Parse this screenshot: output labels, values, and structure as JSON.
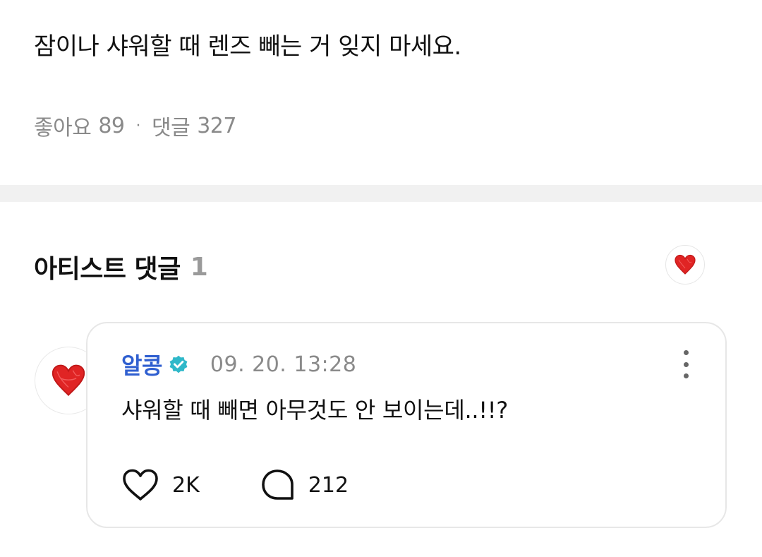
{
  "post": {
    "body": "잠이나 샤워할 때 렌즈 빼는 거 잊지 마세요.",
    "likes_label": "좋아요",
    "likes_count": "89",
    "separator": "·",
    "comments_label": "댓글",
    "comments_count": "327"
  },
  "artist_comments": {
    "title": "아티스트 댓글",
    "count": "1",
    "badge_icon": "red-heart-icon"
  },
  "comment": {
    "author": "알콩",
    "verified_icon": "verified-badge-icon",
    "timestamp": "09. 20. 13:28",
    "text": "샤워할 때 빼면 아무것도 안 보이는데..!!?",
    "like_count": "2K",
    "reply_count": "212",
    "avatar_icon": "red-heart-icon"
  },
  "colors": {
    "author": "#2f5fd0",
    "verified": "#2fb8c9",
    "heart": "#e02424",
    "muted": "#8a8a8a",
    "divider": "#f1f1f1"
  }
}
